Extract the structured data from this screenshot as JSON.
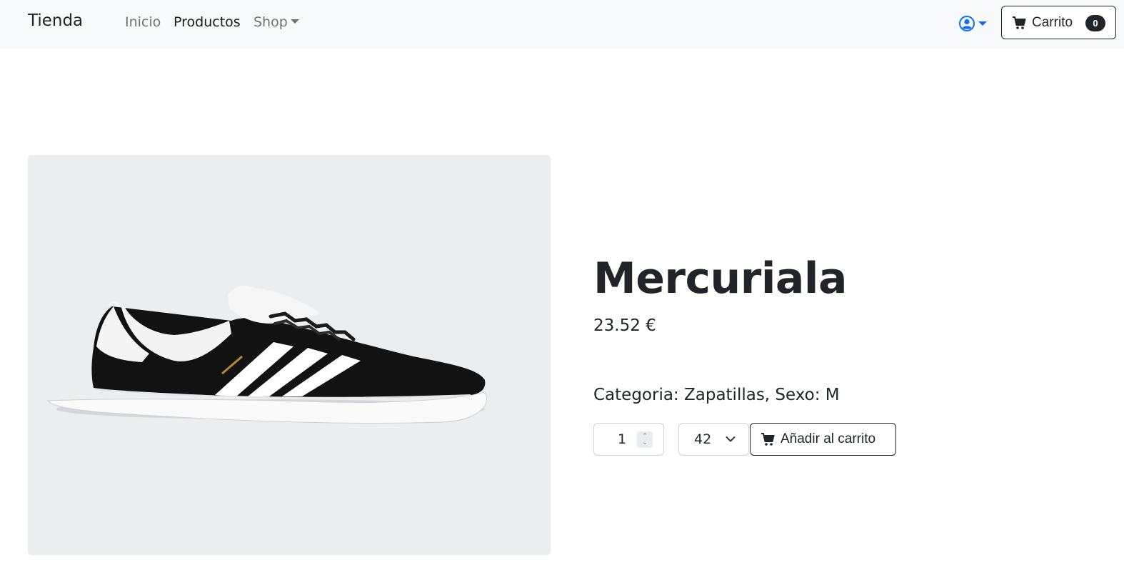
{
  "navbar": {
    "brand": "Tienda",
    "links": [
      {
        "label": "Inicio"
      },
      {
        "label": "Productos"
      },
      {
        "label": "Shop"
      }
    ],
    "user_icon": "user-circle-icon",
    "cart": {
      "label": "Carrito",
      "count": "0",
      "icon": "cart-icon"
    }
  },
  "product": {
    "title": "Mercuriala",
    "price": "23.52 €",
    "meta": "Categoria: Zapatillas, Sexo: M",
    "image": "sneaker-image",
    "quantity": "1",
    "size": "42",
    "add_to_cart_label": "Añadir al carrito"
  },
  "colors": {
    "navbar_bg": "#f8f9fa",
    "image_bg": "#ecedef",
    "primary": "#0d6efd",
    "dark": "#212529"
  }
}
